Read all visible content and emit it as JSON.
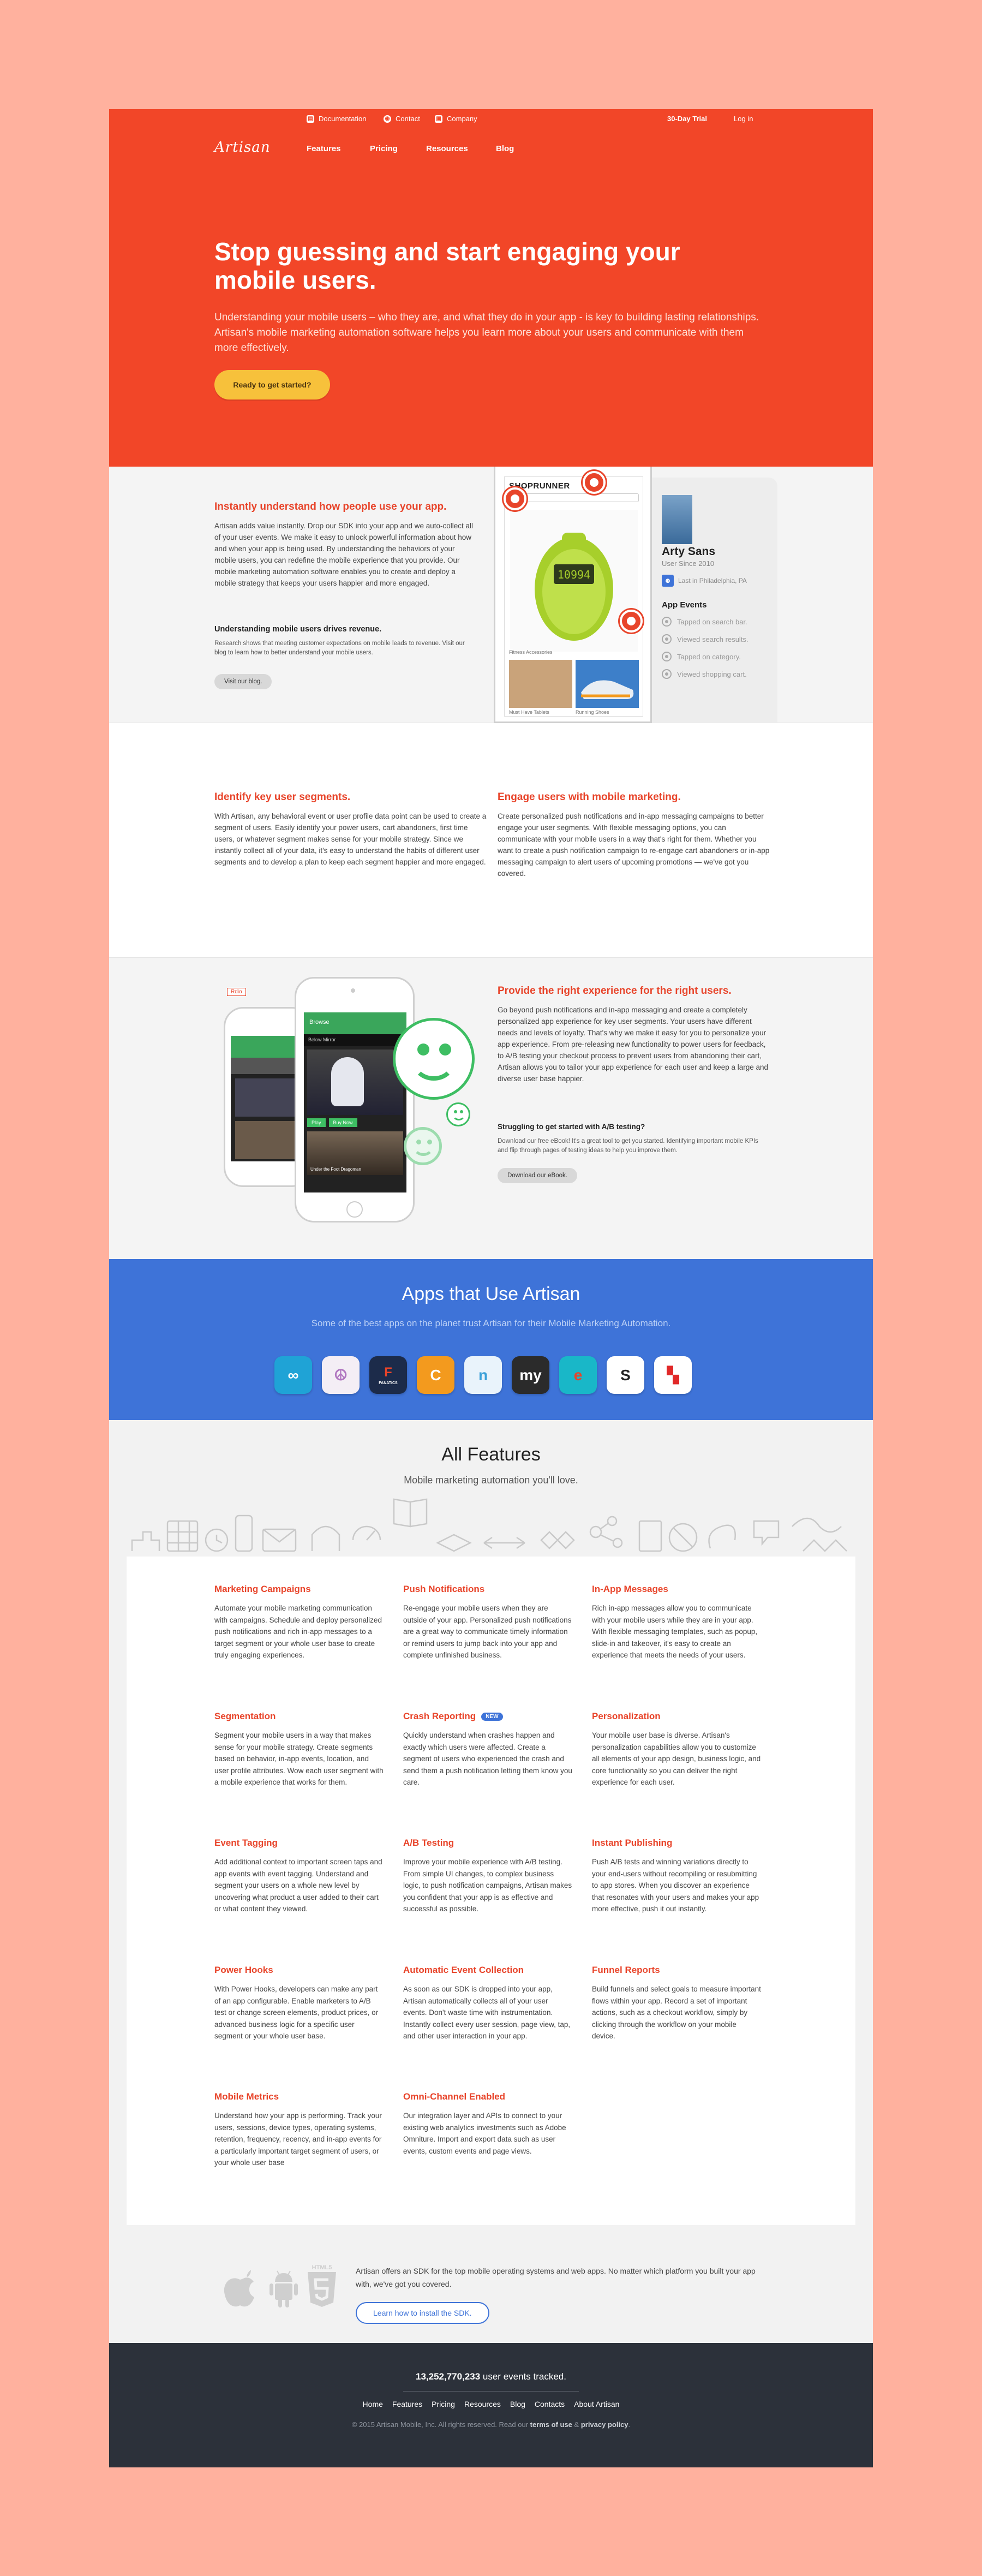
{
  "topbar": {
    "documentation": "Documentation",
    "contact": "Contact",
    "company": "Company",
    "trial": "30-Day Trial",
    "login": "Log in"
  },
  "brand": {
    "logo": "Artisan"
  },
  "nav": {
    "features": "Features",
    "pricing": "Pricing",
    "resources": "Resources",
    "blog": "Blog"
  },
  "hero": {
    "title": "Stop guessing and start engaging your mobile users.",
    "lede": "Understanding your mobile users – who they are, and what they do in your app - is key to building lasting relationships. Artisan's mobile marketing automation software helps you learn more about your users and communicate with them more effectively.",
    "cta": "Ready to get started?"
  },
  "understand": {
    "title": "Instantly understand how people use your app.",
    "body": "Artisan adds value instantly. Drop our SDK into your app and we auto-collect all of your user events. We make it easy to unlock powerful information about how and when your app is being used. By understanding the behaviors of your mobile users, you can redefine the mobile experience that you provide. Our mobile marketing automation software enables you to create and deploy a mobile strategy that keeps your users happier and more engaged.",
    "subhead": "Understanding mobile users drives revenue.",
    "small": "Research shows that meeting customer expectations on mobile leads to revenue. Visit our blog to learn how to better understand your mobile users.",
    "button": "Visit our blog."
  },
  "demo": {
    "store": "SHOPRUNNER",
    "device_time": "10994",
    "cat1": "Fitness Accessories",
    "cat2": "Must Have Tablets",
    "cat3": "Running Shoes",
    "user_name": "Arty Sans",
    "user_since": "User Since 2010",
    "location": "Last in Philadelphia, PA",
    "events_title": "App Events",
    "events": [
      "Tapped on search bar.",
      "Viewed search results.",
      "Tapped on category.",
      "Viewed shopping cart."
    ]
  },
  "segments": {
    "title": "Identify key user segments.",
    "body": "With Artisan, any behavioral event or user profile data point can be used to create a segment of users. Easily identify your power users, cart abandoners, first time users, or whatever segment makes sense for your mobile strategy. Since we instantly collect all of your data, it's easy to understand the habits of different user segments and to develop a plan to keep each segment happier and more engaged."
  },
  "engage": {
    "title": "Engage users with mobile marketing.",
    "body": "Create personalized push notifications and in-app messaging campaigns to better engage your user segments. With flexible messaging options, you can communicate with your mobile users in a way that's right for them. Whether you want to create a push notification campaign to re-engage cart abandoners or in-app messaging campaign to alert users of upcoming promotions — we've got you covered."
  },
  "experience": {
    "title": "Provide the right experience for the right users.",
    "body": "Go beyond push notifications and in-app messaging and create a completely personalized app experience for key user segments. Your users have different needs and levels of loyalty. That's why we make it easy for you to personalize your app experience. From pre-releasing new functionality to power users for feedback, to A/B testing your checkout process to prevent users from abandoning their cart, Artisan allows you to tailor your app experience for each user and keep a large and diverse user base happier.",
    "subhead": "Struggling to get started with A/B testing?",
    "small": "Download our free eBook! It's a great tool to get you started. Identifying important mobile KPIs and flip through pages of testing ideas to help you improve them.",
    "button": "Download our eBook.",
    "phone_label": "Rdio",
    "phone_browse": "Browse",
    "phone_header": "Below Mirror",
    "phone_play": "Play",
    "phone_buy": "Buy Now",
    "phone_album": "Under the Foot Dragoman"
  },
  "apps": {
    "title": "Apps that Use Artisan",
    "subtitle": "Some of the best apps on the planet trust Artisan for their Mobile Marketing Automation.",
    "icons": [
      {
        "name": "ooVoo",
        "glyph": "∞",
        "bg": "#1fa3d6",
        "fg": "#ffffff"
      },
      {
        "name": "peace",
        "glyph": "☮",
        "bg": "#f4eef5",
        "fg": "#b076c0"
      },
      {
        "name": "Fanatics",
        "glyph": "F",
        "bg": "#1c2b4a",
        "fg": "#e8442a",
        "label": "FANATICS"
      },
      {
        "name": "crescent",
        "glyph": "C",
        "bg": "#f39a1e",
        "fg": "#ffffff"
      },
      {
        "name": "n",
        "glyph": "n",
        "bg": "#e9f3fb",
        "fg": "#3aa0d8"
      },
      {
        "name": "my",
        "glyph": "my",
        "bg": "#2b2b2b",
        "fg": "#ffffff"
      },
      {
        "name": "e",
        "glyph": "e",
        "bg": "#19b7c8",
        "fg": "#e8442a"
      },
      {
        "name": "S",
        "glyph": "S",
        "bg": "#ffffff",
        "fg": "#222222"
      },
      {
        "name": "Flipboard",
        "glyph": "▚",
        "bg": "#ffffff",
        "fg": "#e12828"
      }
    ]
  },
  "features": {
    "title": "All Features",
    "subtitle": "Mobile marketing automation you'll love.",
    "new_badge": "NEW",
    "items": [
      {
        "title": "Marketing Campaigns",
        "desc": "Automate your mobile marketing communication with campaigns. Schedule and deploy personalized push notifications and rich in-app messages to a target segment or your whole user base to create truly engaging experiences."
      },
      {
        "title": "Push Notifications",
        "desc": "Re-engage your mobile users when they are outside of your app. Personalized push notifications are a great way to communicate timely information or remind users to jump back into your app and complete unfinished business."
      },
      {
        "title": "In-App Messages",
        "desc": "Rich in-app messages allow you to communicate with your mobile users while they are in your app. With flexible messaging templates, such as popup, slide-in and takeover, it's easy to create an experience that meets the needs of your users."
      },
      {
        "title": "Segmentation",
        "desc": "Segment your mobile users in a way that makes sense for your mobile strategy. Create segments based on behavior, in-app events, location, and user profile attributes. Wow each user segment with a mobile experience that works for them."
      },
      {
        "title": "Crash Reporting",
        "desc": "Quickly understand when crashes happen and exactly which users were affected. Create a segment of users who experienced the crash and send them a push notification letting them know you care."
      },
      {
        "title": "Personalization",
        "desc": "Your mobile user base is diverse. Artisan's personalization capabilities allow you to customize all elements of your app design, business logic, and core functionality so you can deliver the right experience for each user."
      },
      {
        "title": "Event Tagging",
        "desc": "Add additional context to important screen taps and app events with event tagging. Understand and segment your users on a whole new level by uncovering what product a user added to their cart or what content they viewed."
      },
      {
        "title": "A/B Testing",
        "desc": "Improve your mobile experience with A/B testing. From simple UI changes, to complex business logic, to push notification campaigns, Artisan makes you confident that your app is as effective and successful as possible."
      },
      {
        "title": "Instant Publishing",
        "desc": "Push A/B tests and winning variations directly to your end-users without recompiling or resubmitting to app stores. When you discover an experience that resonates with your users and makes your app more effective, push it out instantly."
      },
      {
        "title": "Power Hooks",
        "desc": "With Power Hooks, developers can make any part of an app configurable. Enable marketers to A/B test or change screen elements, product prices, or advanced business logic for a specific user segment or your whole user base."
      },
      {
        "title": "Automatic Event Collection",
        "desc": "As soon as our SDK is dropped into your app, Artisan automatically collects all of your user events. Don't waste time with instrumentation. Instantly collect every user session, page view, tap, and other user interaction in your app."
      },
      {
        "title": "Funnel Reports",
        "desc": "Build funnels and select goals to measure important flows within your app. Record a set of important actions, such as a checkout workflow, simply by clicking through the workflow on your mobile device."
      },
      {
        "title": "Mobile Metrics",
        "desc": "Understand how your app is performing. Track your users, sessions, device types, operating systems, retention, frequency, recency, and in-app events for a particularly important target segment of users, or your whole user base"
      },
      {
        "title": "Omni-Channel Enabled",
        "desc": "Our integration layer and APIs to connect to your existing web analytics investments such as Adobe Omniture. Import and export data such as user events, custom events and page views."
      }
    ]
  },
  "platforms": {
    "html5": "HTML5",
    "text": "Artisan offers an SDK for the top mobile operating systems and web apps. No matter which platform you built your app with, we've got you covered.",
    "button": "Learn how to install the SDK."
  },
  "footer": {
    "count": "13,252,770,233",
    "count_label": " user events tracked.",
    "links": [
      "Home",
      "Features",
      "Pricing",
      "Resources",
      "Blog",
      "Contacts",
      "About Artisan"
    ],
    "legal_prefix": "© 2015 Artisan Mobile, Inc. All rights reserved. Read our ",
    "terms": "terms of use",
    "amp": " & ",
    "privacy": "privacy policy",
    "period": "."
  },
  "colors": {
    "page_bg": "#ffb19e",
    "hero": "#f24628",
    "accent": "#e8442a",
    "cta": "#f7c13b",
    "apps_band": "#3e73d8",
    "footer": "#2c313a",
    "smiley": "#3ebe63"
  }
}
